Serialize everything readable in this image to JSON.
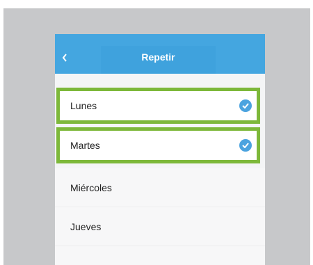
{
  "header": {
    "title": "Repetir",
    "back_icon": "chevron-left-icon"
  },
  "days": [
    {
      "label": "Lunes",
      "selected": true
    },
    {
      "label": "Martes",
      "selected": true
    },
    {
      "label": "Miércoles",
      "selected": false
    },
    {
      "label": "Jueves",
      "selected": false
    }
  ],
  "colors": {
    "header": "#44a6e0",
    "check": "#4ba3df",
    "highlight": "#7db83a",
    "backdrop": "#c7c8ca"
  }
}
